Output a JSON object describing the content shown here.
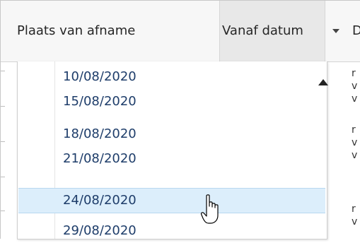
{
  "header": {
    "columns": [
      {
        "label": "Plaats van afname"
      },
      {
        "label": "Vanaf datum"
      },
      {
        "label": "D"
      }
    ]
  },
  "dropdown": {
    "items": [
      {
        "label": "10/08/2020"
      },
      {
        "label": "15/08/2020"
      },
      {
        "label": "18/08/2020"
      },
      {
        "label": "21/08/2020"
      },
      {
        "label": "24/08/2020",
        "selected": true
      },
      {
        "label": "29/08/2020"
      }
    ]
  },
  "right_column": {
    "fragments": [
      "r",
      "v",
      "v",
      "r",
      "v",
      "v",
      "r",
      "v"
    ]
  },
  "colors": {
    "selected_row": "#dceefb",
    "item_text": "#1e3d6a",
    "header_bg": "#f7f7f7"
  },
  "icons": {
    "sort": "chevron-down-icon",
    "scroll": "chevron-up-icon",
    "cursor": "hand-pointer-icon"
  }
}
